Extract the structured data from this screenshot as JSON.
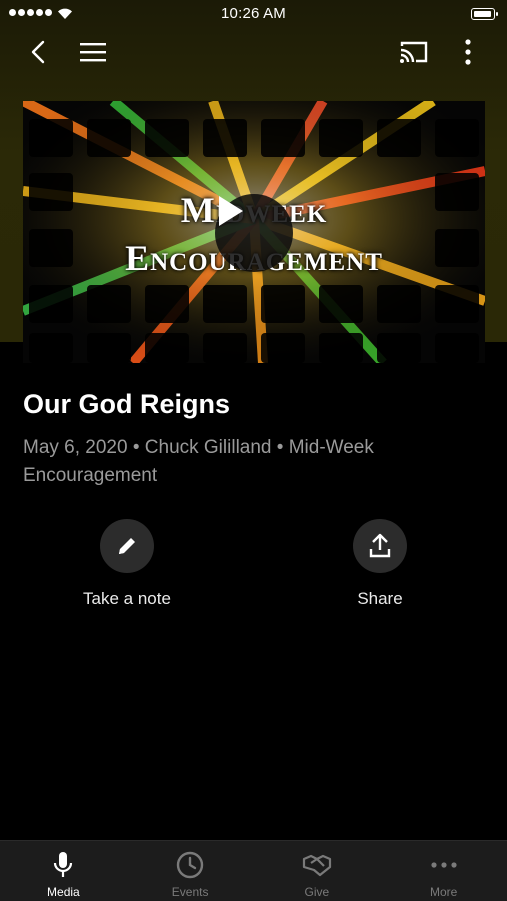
{
  "status_bar": {
    "time": "10:26 AM"
  },
  "video": {
    "thumbnail_title_line1": "Midweek",
    "thumbnail_title_line2": "Encouragement"
  },
  "sermon": {
    "title": "Our God Reigns",
    "meta": "May 6, 2020 • Chuck Gililland • Mid-Week Encouragement"
  },
  "actions": [
    {
      "label": "Take a note",
      "icon": "pencil-icon"
    },
    {
      "label": "Share",
      "icon": "share-icon"
    }
  ],
  "tabs": [
    {
      "label": "Media",
      "icon": "microphone-icon",
      "active": true
    },
    {
      "label": "Events",
      "icon": "clock-icon",
      "active": false
    },
    {
      "label": "Give",
      "icon": "handshake-icon",
      "active": false
    },
    {
      "label": "More",
      "icon": "more-dots-icon",
      "active": false
    }
  ],
  "colors": {
    "background": "#000000",
    "header": "#2a2806",
    "tabbar": "#1c1c1c"
  }
}
